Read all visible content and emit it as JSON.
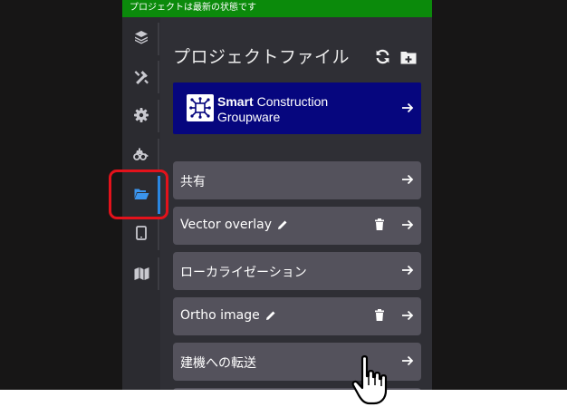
{
  "status": {
    "text": "プロジェクトは最新の状態です",
    "color": "#0b8a0b"
  },
  "rail": {
    "items": [
      {
        "name": "layers-icon"
      },
      {
        "name": "tools-icon"
      },
      {
        "name": "gear-icon"
      },
      {
        "name": "excavator-icon"
      },
      {
        "name": "folder-open-icon",
        "active": true
      },
      {
        "name": "tablet-icon"
      },
      {
        "name": "map-icon"
      }
    ],
    "active_color": "#2a86e0",
    "highlight_color": "#e3121b"
  },
  "panel": {
    "title": "プロジェクトファイル",
    "header_icons": [
      "sync-icon",
      "folder-plus-icon"
    ]
  },
  "banner": {
    "title_bold": "Smart",
    "title_rest": "Construction",
    "subtitle": "Groupware",
    "background": "#06067e"
  },
  "files": [
    {
      "label": "共有",
      "editable": false,
      "deletable": false
    },
    {
      "label": "Vector overlay",
      "editable": true,
      "deletable": true
    },
    {
      "label": "ローカライゼーション",
      "editable": false,
      "deletable": false
    },
    {
      "label": "Ortho image",
      "editable": true,
      "deletable": true
    },
    {
      "label": "建機への転送",
      "editable": false,
      "deletable": false
    }
  ]
}
